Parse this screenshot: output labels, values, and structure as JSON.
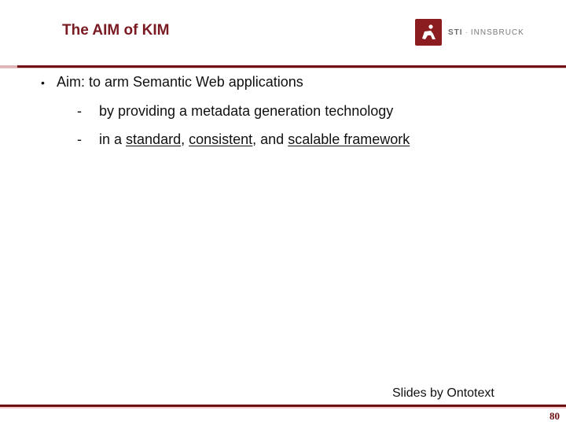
{
  "header": {
    "title": "The AIM of KIM",
    "logo": {
      "icon": "sti-runner-icon",
      "brand_bold": "STI",
      "separator": "·",
      "brand_rest": "INNSBRUCK"
    }
  },
  "content": {
    "bullet": {
      "marker": "•",
      "text": "Aim: to arm Semantic Web applications"
    },
    "sub_items": [
      {
        "marker": "-",
        "text": "by providing a metadata generation technology"
      },
      {
        "marker": "-",
        "parts": {
          "p1": "in a ",
          "u1": "standard",
          "p2": ", ",
          "u2": "consistent",
          "p3": ", and ",
          "u3": "scalable framework"
        }
      }
    ]
  },
  "footer": {
    "credit": "Slides by Ontotext",
    "page_number": "80"
  },
  "colors": {
    "accent": "#7a1a22",
    "rule": "#6e0f14",
    "logo_bg": "#8b1c20"
  }
}
